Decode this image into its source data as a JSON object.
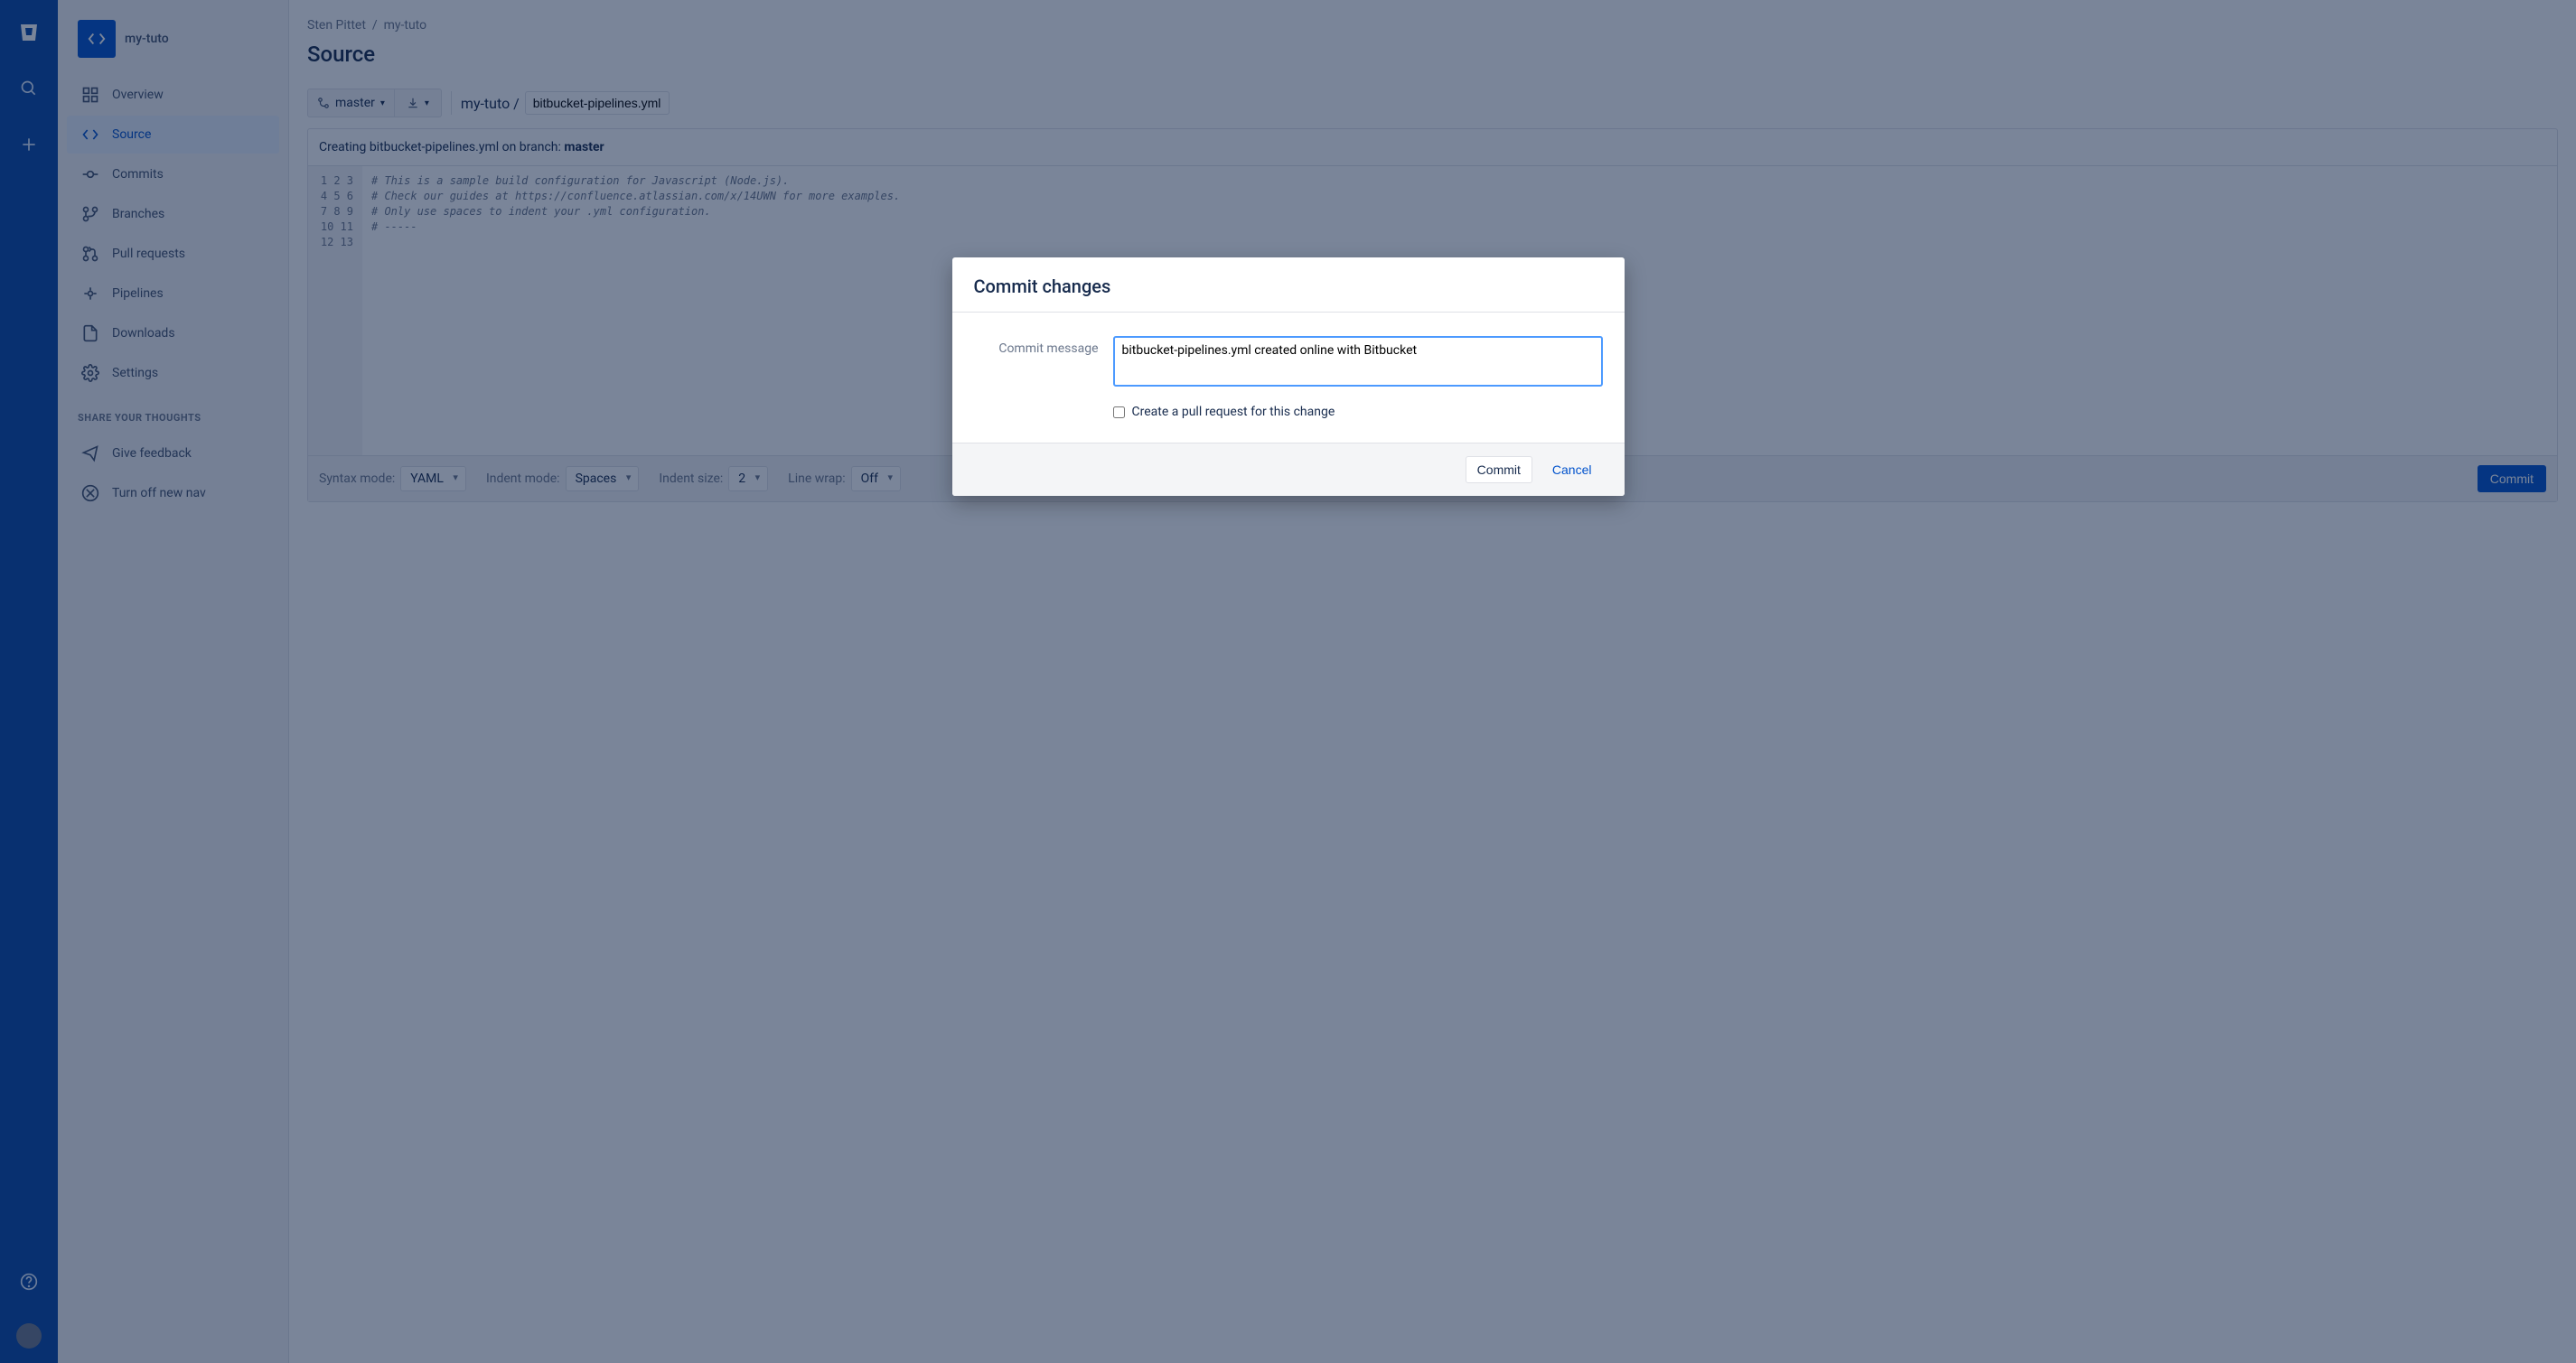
{
  "globalNav": {
    "logo": "bitbucket-logo",
    "search": "search",
    "create": "create"
  },
  "sidebar": {
    "repoName": "my-tuto",
    "items": [
      {
        "id": "overview",
        "label": "Overview"
      },
      {
        "id": "source",
        "label": "Source",
        "active": true
      },
      {
        "id": "commits",
        "label": "Commits"
      },
      {
        "id": "branches",
        "label": "Branches"
      },
      {
        "id": "pullrequests",
        "label": "Pull requests"
      },
      {
        "id": "pipelines",
        "label": "Pipelines"
      },
      {
        "id": "downloads",
        "label": "Downloads"
      },
      {
        "id": "settings",
        "label": "Settings"
      }
    ],
    "sectionTitle": "SHARE YOUR THOUGHTS",
    "feedback": [
      {
        "id": "givefeedback",
        "label": "Give feedback"
      },
      {
        "id": "turnoffnav",
        "label": "Turn off new nav"
      }
    ]
  },
  "breadcrumb": {
    "owner": "Sten Pittet",
    "repo": "my-tuto"
  },
  "pageTitle": "Source",
  "toolbar": {
    "branch": "master",
    "pathRepo": "my-tuto",
    "fileName": "bitbucket-pipelines.yml"
  },
  "editor": {
    "creatingPrefix": "Creating bitbucket-pipelines.yml on branch: ",
    "creatingBranch": "master",
    "lineCount": 13,
    "codeLines": [
      "# This is a sample build configuration for Javascript (Node.js).",
      "# Check our guides at https://confluence.atlassian.com/x/14UWN for more examples.",
      "# Only use spaces to indent your .yml configuration.",
      "# -----"
    ],
    "footer": {
      "syntaxLabel": "Syntax mode:",
      "syntaxValue": "YAML",
      "indentModeLabel": "Indent mode:",
      "indentModeValue": "Spaces",
      "indentSizeLabel": "Indent size:",
      "indentSizeValue": "2",
      "lineWrapLabel": "Line wrap:",
      "lineWrapValue": "Off",
      "commitLabel": "Commit"
    }
  },
  "modal": {
    "title": "Commit changes",
    "messageLabel": "Commit message",
    "messageValue": "bitbucket-pipelines.yml created online with Bitbucket",
    "pullRequestLabel": "Create a pull request for this change",
    "commitLabel": "Commit",
    "cancelLabel": "Cancel"
  }
}
